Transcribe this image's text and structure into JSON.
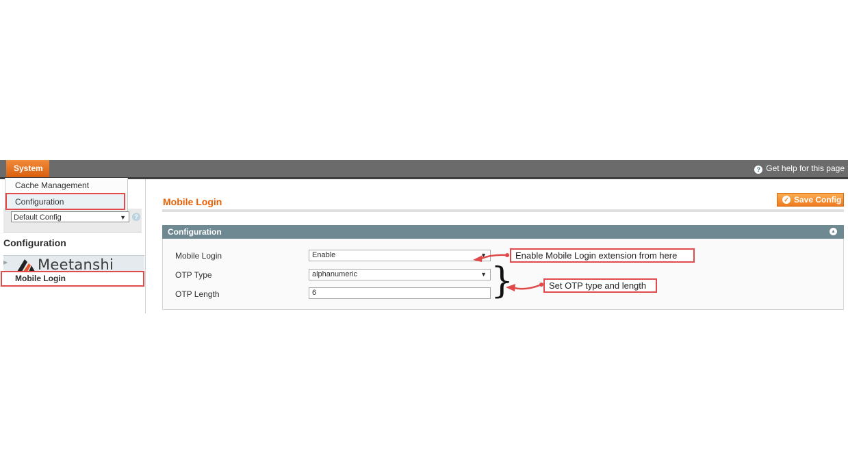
{
  "topbar": {
    "menu_label": "System",
    "help_label": "Get help for this page"
  },
  "dropdown": {
    "items": [
      "Cache Management",
      "Configuration"
    ]
  },
  "scope": {
    "selected": "Default Config"
  },
  "sidebar": {
    "title": "Configuration",
    "vendor": "Meetanshi",
    "item": "Mobile Login"
  },
  "main": {
    "title": "Mobile Login",
    "save_label": "Save Config",
    "section_title": "Configuration",
    "fields": [
      {
        "label": "Mobile Login",
        "value": "Enable"
      },
      {
        "label": "OTP Type",
        "value": "alphanumeric"
      },
      {
        "label": "OTP Length",
        "value": "6"
      }
    ]
  },
  "annotations": {
    "note1": "Enable Mobile Login extension from here",
    "note2": "Set OTP type and length"
  },
  "colors": {
    "accent_orange": "#eb5e00",
    "highlight_red": "#e04a4a",
    "section_header": "#6f8992"
  }
}
